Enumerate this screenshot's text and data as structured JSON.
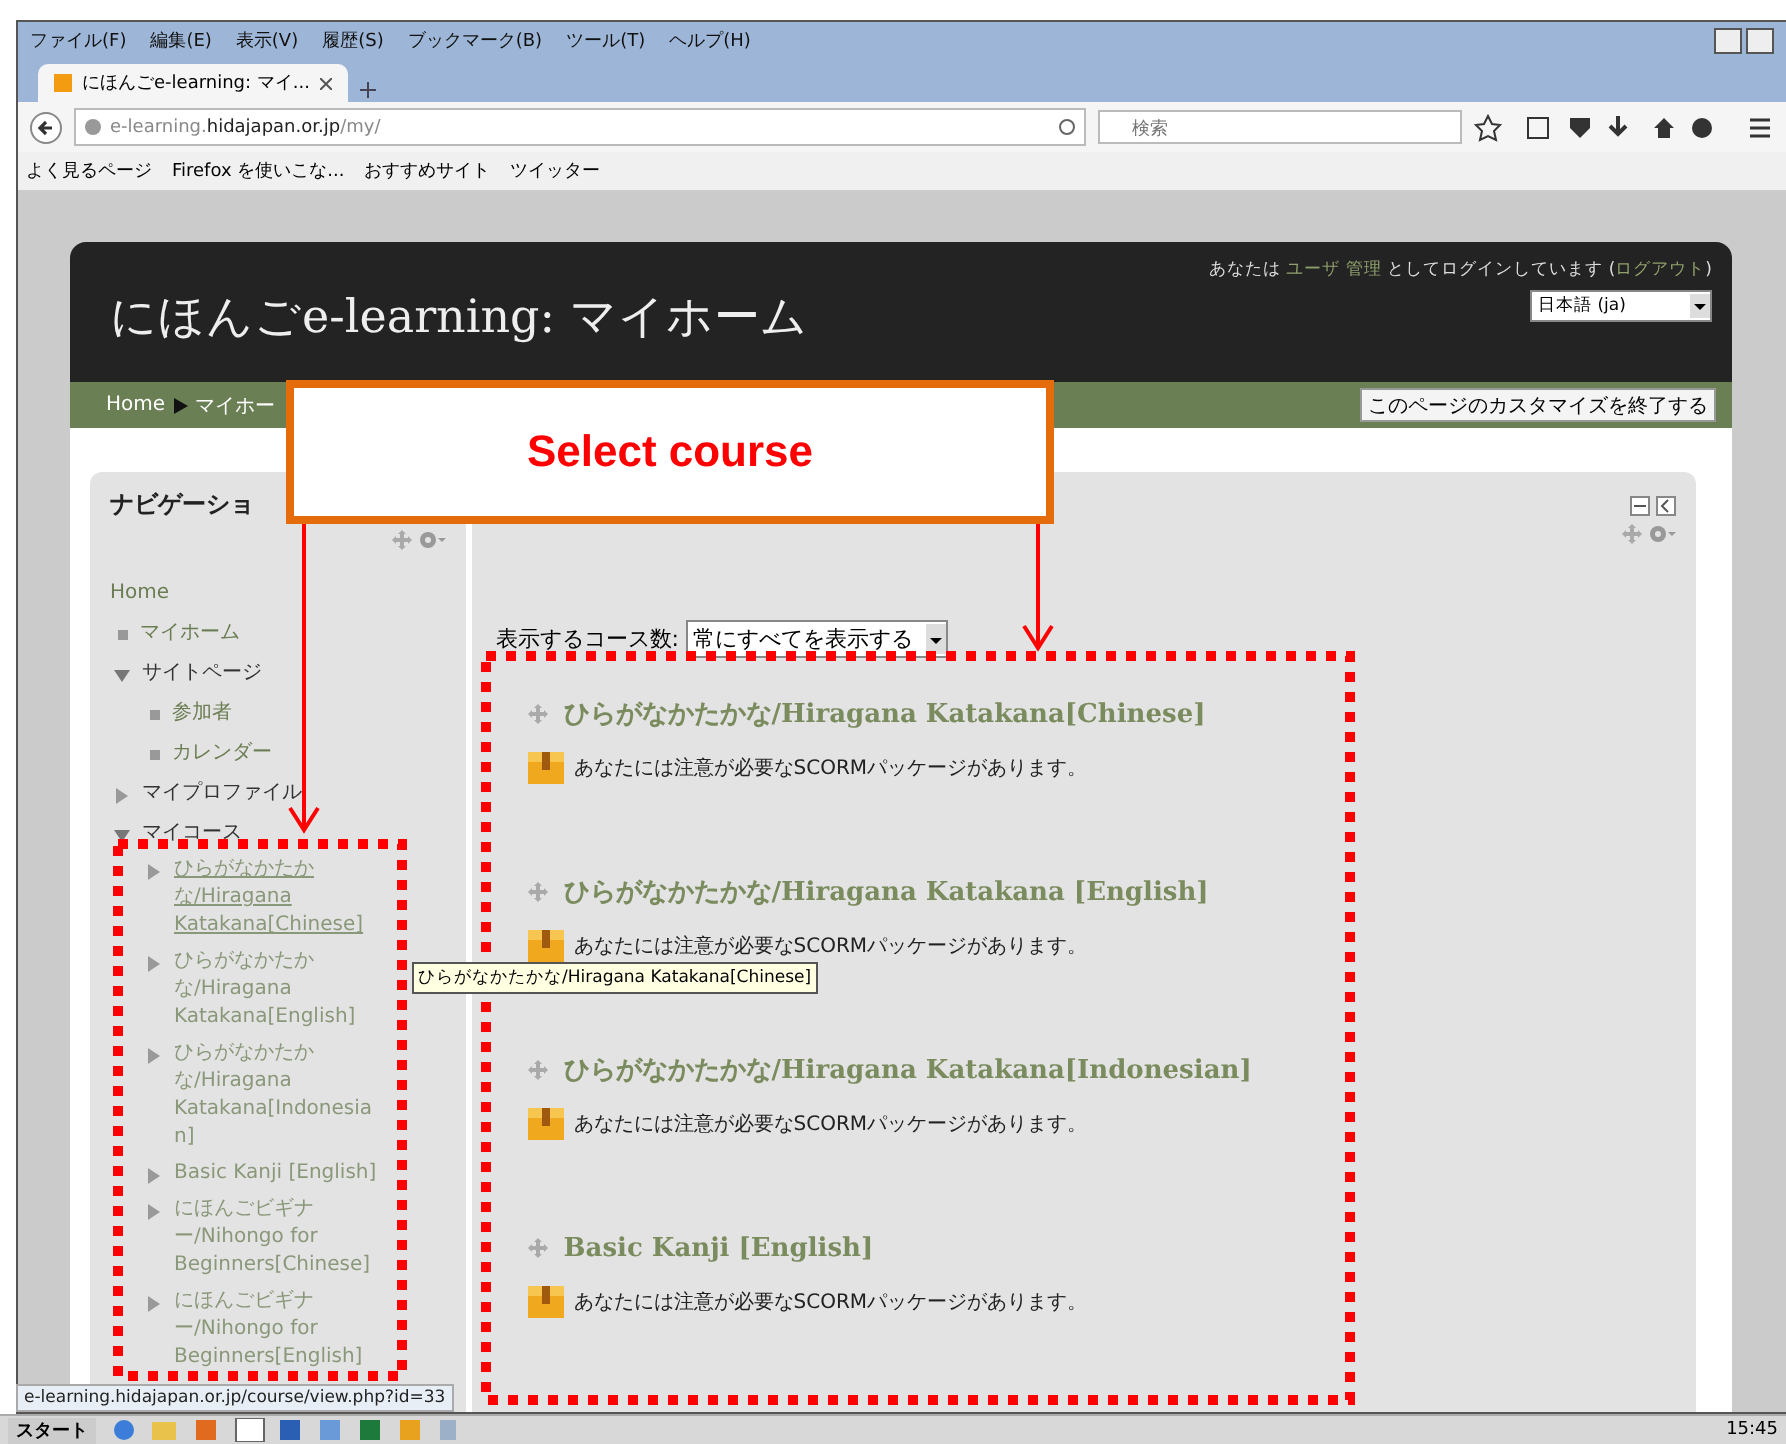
{
  "menu_bar": [
    "ファイル(F)",
    "編集(E)",
    "表示(V)",
    "履歴(S)",
    "ブックマーク(B)",
    "ツール(T)",
    "ヘルプ(H)"
  ],
  "tabs": [
    {
      "title": "にほんごe-learning: マイ...",
      "selected": true
    }
  ],
  "address": {
    "url": "e-learning.**hidajapan.or.jp**/my/"
  },
  "search": {
    "placeholder": "検索"
  },
  "bookmarks": [
    "よく見るページ",
    "Firefox を使いこな...",
    "おすすめサイト",
    "ツイッター"
  ],
  "page": {
    "site_title": "にほんごe-learning: マイホーム",
    "login": {
      "prefix": "あなたは",
      "user": "ユーザ 管理",
      "middle": "としてログインしています (",
      "logout": "ログアウト",
      "suffix": ")"
    },
    "language": "日本語 (ja)",
    "breadcrumb": [
      "Home",
      "マイホー"
    ],
    "customize_button": "このページのカスタマイズを終了する",
    "navigation": {
      "title": "ナビゲーショ",
      "items": [
        {
          "kind": "link",
          "label": "Home",
          "children": [
            {
              "kind": "leaf",
              "label": "マイホーム"
            },
            {
              "kind": "branch",
              "label": "サイトページ",
              "expanded": true,
              "children": [
                {
                  "kind": "leaf",
                  "label": "参加者"
                },
                {
                  "kind": "leaf",
                  "label": "カレンダー"
                }
              ]
            },
            {
              "kind": "branch",
              "label": "マイプロファイル",
              "expanded": false
            },
            {
              "kind": "branch",
              "label": "マイコース",
              "expanded": true,
              "children": [
                {
                  "kind": "course",
                  "label": "ひらがなかたかな/Hiragana Katakana[Chinese]",
                  "hovered": true
                },
                {
                  "kind": "course",
                  "label": "ひらがなかたかな/Hiragana Katakana[English]",
                  "hovered": false
                },
                {
                  "kind": "course",
                  "label": "ひらがなかたかな/Hiragana Katakana[Indonesian]",
                  "hovered": false
                },
                {
                  "kind": "course",
                  "label": "Basic Kanji [English]",
                  "hovered": false
                },
                {
                  "kind": "course",
                  "label": "にほんごビギナー/Nihongo for Beginners[Chinese]",
                  "hovered": false
                },
                {
                  "kind": "course",
                  "label": "にほんごビギナー/Nihongo for Beginners[English]",
                  "hovered": false
                }
              ]
            }
          ]
        }
      ]
    },
    "courses_per_page": {
      "label": "表示するコース数:",
      "value": "常にすべてを表示する"
    },
    "courses": [
      {
        "title": "ひらがなかたかな/Hiragana Katakana[Chinese]",
        "notice": "あなたには注意が必要なSCORMパッケージがあります。"
      },
      {
        "title": "ひらがなかたかな/Hiragana Katakana [English]",
        "notice": "あなたには注意が必要なSCORMパッケージがあります。"
      },
      {
        "title": "ひらがなかたかな/Hiragana Katakana[Indonesian]",
        "notice": "あなたには注意が必要なSCORMパッケージがあります。"
      },
      {
        "title": "Basic Kanji [English]",
        "notice": "あなたには注意が必要なSCORMパッケージがあります。"
      }
    ]
  },
  "annotation": {
    "callout": "Select course"
  },
  "tooltip": "ひらがなかたかな/Hiragana Katakana[Chinese]",
  "status_url": "e-learning.hidajapan.or.jp/course/view.php?id=33",
  "taskbar": {
    "start": "スタート",
    "time": "15:45"
  }
}
